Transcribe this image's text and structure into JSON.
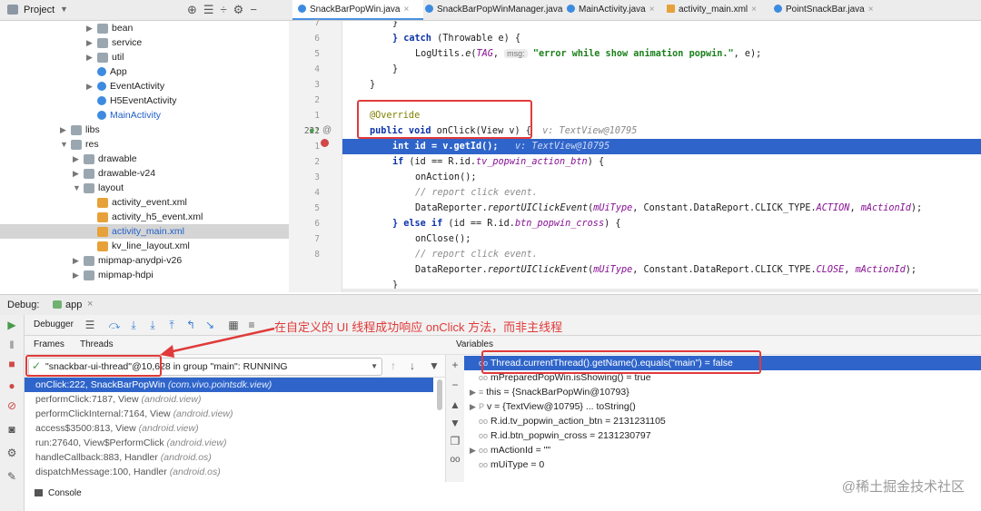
{
  "project_panel": {
    "title": "Project",
    "tree": [
      {
        "label": "bean",
        "kind": "folder",
        "arrow": "▶"
      },
      {
        "label": "service",
        "kind": "folder",
        "arrow": "▶"
      },
      {
        "label": "util",
        "kind": "folder",
        "arrow": "▶"
      },
      {
        "label": "App",
        "kind": "class",
        "arrow": ""
      },
      {
        "label": "EventActivity",
        "kind": "class",
        "arrow": "▶"
      },
      {
        "label": "H5EventActivity",
        "kind": "class",
        "arrow": ""
      },
      {
        "label": "MainActivity",
        "kind": "class",
        "arrow": ""
      },
      {
        "label": "libs",
        "kind": "folder",
        "arrow": "▶"
      },
      {
        "label": "res",
        "kind": "folder",
        "arrow": "▼"
      },
      {
        "label": "drawable",
        "kind": "folder",
        "arrow": "▶"
      },
      {
        "label": "drawable-v24",
        "kind": "folder",
        "arrow": "▶"
      },
      {
        "label": "layout",
        "kind": "folder",
        "arrow": "▼"
      },
      {
        "label": "activity_event.xml",
        "kind": "xml",
        "arrow": ""
      },
      {
        "label": "activity_h5_event.xml",
        "kind": "xml",
        "arrow": ""
      },
      {
        "label": "activity_main.xml",
        "kind": "xml",
        "arrow": ""
      },
      {
        "label": "kv_line_layout.xml",
        "kind": "xml",
        "arrow": ""
      },
      {
        "label": "mipmap-anydpi-v26",
        "kind": "folder",
        "arrow": "▶"
      },
      {
        "label": "mipmap-hdpi",
        "kind": "folder",
        "arrow": "▶"
      }
    ]
  },
  "editor_tabs": [
    {
      "label": "SnackBarPopWin.java",
      "kind": "class",
      "active": true
    },
    {
      "label": "SnackBarPopWinManager.java",
      "kind": "class",
      "active": false
    },
    {
      "label": "MainActivity.java",
      "kind": "class",
      "active": false
    },
    {
      "label": "activity_main.xml",
      "kind": "xml",
      "active": false
    },
    {
      "label": "PointSnackBar.java",
      "kind": "class",
      "active": false
    }
  ],
  "gutter_numbers": [
    "7",
    "6",
    "5",
    "4",
    "3",
    "2",
    "1",
    "222",
    "1",
    "2",
    "3",
    "4",
    "5",
    "6",
    "7",
    "8"
  ],
  "code": {
    "l1": "}",
    "l2_kw": "} catch",
    "l2_rest": " (Throwable e) {",
    "l3_a": "LogUtils.",
    "l3_b": "e",
    "l3_c": "(",
    "l3_d": "TAG",
    "l3_e": ", ",
    "l3_param": "msg:",
    "l3_str": "\"error while show animation popwin.\"",
    "l3_f": ", e);",
    "l4": "}",
    "l5": "}",
    "l7": "@Override",
    "l8_kw": "public void",
    "l8_rest": " onClick(View v) {",
    "l8_hint": "v: TextView@10795",
    "l9_kw": "int",
    "l9_rest": " id = v.getId();",
    "l9_hint": "v: TextView@10795",
    "l10_kw": "if",
    "l10_a": " (id == R.id.",
    "l10_f": "tv_popwin_action_btn",
    "l10_b": ") {",
    "l11": "onAction();",
    "l12": "// report click event.",
    "l13_a": "DataReporter.",
    "l13_m": "reportUIClickEvent",
    "l13_b": "(",
    "l13_f1": "mUiType",
    "l13_c": ", Constant.DataReport.CLICK_TYPE.",
    "l13_f2": "ACTION",
    "l13_d": ", ",
    "l13_f3": "mActionId",
    "l13_e": ");",
    "l14_kw": "} else if",
    "l14_a": " (id == R.id.",
    "l14_f": "btn_popwin_cross",
    "l14_b": ") {",
    "l15": "onClose();",
    "l16": "// report click event.",
    "l17_a": "DataReporter.",
    "l17_m": "reportUIClickEvent",
    "l17_b": "(",
    "l17_f1": "mUiType",
    "l17_c": ", Constant.DataReport.CLICK_TYPE.",
    "l17_f2": "CLOSE",
    "l17_d": ", ",
    "l17_f3": "mActionId",
    "l17_e": ");",
    "l18": "}"
  },
  "debug": {
    "label": "Debug:",
    "config": "app",
    "tab_debugger": "Debugger",
    "tab_console": "Console",
    "frames_title": "Frames",
    "threads_title": "Threads",
    "variables_title": "Variables",
    "thread_selected": "\"snackbar-ui-thread\"@10,628 in group \"main\": RUNNING",
    "frames": [
      {
        "method": "onClick:222, SnackBarPopWin",
        "pkg": "(com.vivo.pointsdk.view)"
      },
      {
        "method": "performClick:7187, View",
        "pkg": "(android.view)"
      },
      {
        "method": "performClickInternal:7164, View",
        "pkg": "(android.view)"
      },
      {
        "method": "access$3500:813, View",
        "pkg": "(android.view)"
      },
      {
        "method": "run:27640, View$PerformClick",
        "pkg": "(android.view)"
      },
      {
        "method": "handleCallback:883, Handler",
        "pkg": "(android.os)"
      },
      {
        "method": "dispatchMessage:100, Handler",
        "pkg": "(android.os)"
      }
    ],
    "variables": [
      {
        "expand": "",
        "icon": "oo",
        "text": "Thread.currentThread().getName().equals(\"main\") = false"
      },
      {
        "expand": "",
        "icon": "oo",
        "text": "mPreparedPopWin.isShowing() = true"
      },
      {
        "expand": "▶",
        "icon": "≡",
        "text": "this = {SnackBarPopWin@10793}"
      },
      {
        "expand": "▶",
        "icon": "P",
        "text": "v = {TextView@10795} ... toString()"
      },
      {
        "expand": "",
        "icon": "oo",
        "text": "R.id.tv_popwin_action_btn = 2131231105"
      },
      {
        "expand": "",
        "icon": "oo",
        "text": "R.id.btn_popwin_cross = 2131230797"
      },
      {
        "expand": "▶",
        "icon": "oo",
        "text": "mActionId = \"\""
      },
      {
        "expand": "",
        "icon": "oo",
        "text": "mUiType = 0"
      }
    ]
  },
  "annotation_text": "在自定义的 UI 线程成功响应 onClick 方法，而非主线程",
  "watermark": "@稀土掘金技术社区",
  "colors": {
    "accent": "#2f65ca",
    "annotation": "#e03a3a",
    "annotation_box": "#e03a3a"
  }
}
